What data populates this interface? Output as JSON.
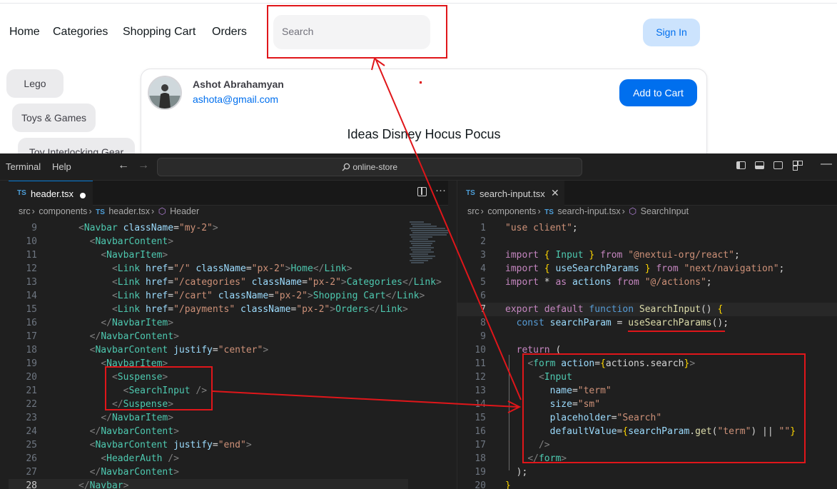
{
  "site": {
    "nav": [
      "Home",
      "Categories",
      "Shopping Cart",
      "Orders"
    ],
    "search_placeholder": "Search",
    "signin_label": "Sign In",
    "categories": [
      "Lego",
      "Toys & Games",
      "Toy Interlocking Gear"
    ],
    "card": {
      "user_name": "Ashot Abrahamyan",
      "user_email": "ashota@gmail.com",
      "add_to_cart": "Add to Cart",
      "title": "Ideas Disney Hocus Pocus"
    }
  },
  "vscode": {
    "menu": [
      "Terminal",
      "Help"
    ],
    "search_text": "online-store",
    "left": {
      "tab_ts": "TS",
      "tab_name": "header.tsx",
      "breadcrumb": [
        "src",
        "components",
        "header.tsx",
        "Header"
      ],
      "active_line": "28",
      "lines": [
        {
          "n": "9",
          "t": "<Navbar className=\"my-2\">"
        },
        {
          "n": "10",
          "t": "  <NavbarContent>"
        },
        {
          "n": "11",
          "t": "    <NavbarItem>"
        },
        {
          "n": "12",
          "t": "      <Link href=\"/\" className=\"px-2\">Home</Link>"
        },
        {
          "n": "13",
          "t": "      <Link href=\"/categories\" className=\"px-2\">Categories</Link>"
        },
        {
          "n": "14",
          "t": "      <Link href=\"/cart\" className=\"px-2\">Shopping Cart</Link>"
        },
        {
          "n": "15",
          "t": "      <Link href=\"/payments\" className=\"px-2\">Orders</Link>"
        },
        {
          "n": "16",
          "t": "    </NavbarItem>"
        },
        {
          "n": "17",
          "t": "  </NavbarContent>"
        },
        {
          "n": "18",
          "t": "  <NavbarContent justify=\"center\">"
        },
        {
          "n": "19",
          "t": "    <NavbarItem>"
        },
        {
          "n": "20",
          "t": "      <Suspense>"
        },
        {
          "n": "21",
          "t": "        <SearchInput />"
        },
        {
          "n": "22",
          "t": "      </Suspense>"
        },
        {
          "n": "23",
          "t": "    </NavbarItem>"
        },
        {
          "n": "24",
          "t": "  </NavbarContent>"
        },
        {
          "n": "25",
          "t": "  <NavbarContent justify=\"end\">"
        },
        {
          "n": "26",
          "t": "    <HeaderAuth />"
        },
        {
          "n": "27",
          "t": "  </NavbarContent>"
        },
        {
          "n": "28",
          "t": "</Navbar>"
        }
      ]
    },
    "right": {
      "tab_ts": "TS",
      "tab_name": "search-input.tsx",
      "breadcrumb": [
        "src",
        "components",
        "search-input.tsx",
        "SearchInput"
      ],
      "active_line": "7",
      "lines": [
        {
          "n": "1",
          "t": "\"use client\";"
        },
        {
          "n": "2",
          "t": ""
        },
        {
          "n": "3",
          "t": "import { Input } from \"@nextui-org/react\";"
        },
        {
          "n": "4",
          "t": "import { useSearchParams } from \"next/navigation\";"
        },
        {
          "n": "5",
          "t": "import * as actions from \"@/actions\";"
        },
        {
          "n": "6",
          "t": ""
        },
        {
          "n": "7",
          "t": "export default function SearchInput() {"
        },
        {
          "n": "8",
          "t": "  const searchParam = useSearchParams();"
        },
        {
          "n": "9",
          "t": ""
        },
        {
          "n": "10",
          "t": "  return ("
        },
        {
          "n": "11",
          "t": "    <form action={actions.search}>"
        },
        {
          "n": "12",
          "t": "      <Input"
        },
        {
          "n": "13",
          "t": "        name=\"term\""
        },
        {
          "n": "14",
          "t": "        size=\"sm\""
        },
        {
          "n": "15",
          "t": "        placeholder=\"Search\""
        },
        {
          "n": "16",
          "t": "        defaultValue={searchParam.get(\"term\") || \"\"}"
        },
        {
          "n": "17",
          "t": "      />"
        },
        {
          "n": "18",
          "t": "    </form>"
        },
        {
          "n": "19",
          "t": "  );"
        },
        {
          "n": "20",
          "t": "}"
        }
      ]
    }
  },
  "colors": {
    "annotation": "#e0161a",
    "accent": "#006fee",
    "editor_bg": "#1f1f1f"
  }
}
